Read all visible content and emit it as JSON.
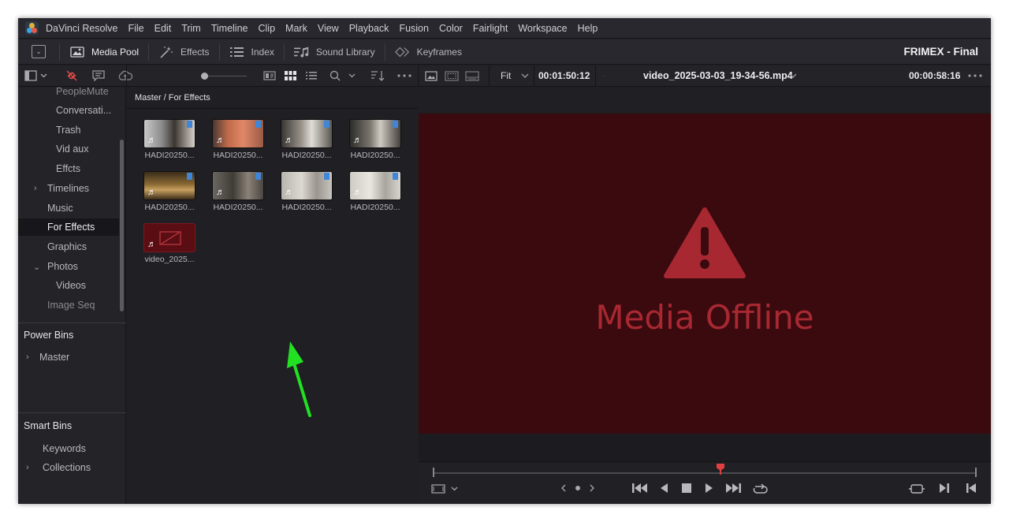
{
  "menubar": {
    "app_name": "DaVinci Resolve",
    "items": [
      "File",
      "Edit",
      "Trim",
      "Timeline",
      "Clip",
      "Mark",
      "View",
      "Playback",
      "Fusion",
      "Color",
      "Fairlight",
      "Workspace",
      "Help"
    ]
  },
  "toolbar": {
    "media_pool": "Media Pool",
    "effects": "Effects",
    "index": "Index",
    "sound_library": "Sound Library",
    "keyframes": "Keyframes",
    "project_title": "FRIMEX - Final"
  },
  "viewer_bar": {
    "zoom": "Fit",
    "source_timecode": "00:01:50:12",
    "clip_name": "video_2025-03-03_19-34-56.mp4",
    "duration_timecode": "00:00:58:16"
  },
  "sidebar": {
    "bins": [
      {
        "label": "PeopleMute"
      },
      {
        "label": "Conversati..."
      },
      {
        "label": "Trash"
      },
      {
        "label": "Vid aux"
      },
      {
        "label": "Effcts"
      },
      {
        "label": "Timelines"
      },
      {
        "label": "Music"
      },
      {
        "label": "For Effects"
      },
      {
        "label": "Graphics"
      },
      {
        "label": "Photos"
      },
      {
        "label": "Videos"
      },
      {
        "label": "Image Seq"
      }
    ],
    "selected_bin": "For Effects",
    "power_bins": {
      "title": "Power Bins",
      "items": [
        "Master"
      ]
    },
    "smart_bins": {
      "title": "Smart Bins",
      "items": [
        "Keywords",
        "Collections"
      ]
    }
  },
  "media_pool": {
    "path": "Master / For Effects",
    "clips": [
      {
        "name": "HADI20250..."
      },
      {
        "name": "HADI20250..."
      },
      {
        "name": "HADI20250..."
      },
      {
        "name": "HADI20250..."
      },
      {
        "name": "HADI20250..."
      },
      {
        "name": "HADI20250..."
      },
      {
        "name": "HADI20250..."
      },
      {
        "name": "HADI20250..."
      },
      {
        "name": "video_2025..."
      }
    ]
  },
  "viewer": {
    "message": "Media Offline"
  },
  "colors": {
    "accent_red": "#e04040",
    "offline_bg": "#3a0a0e",
    "offline_text": "#a82832",
    "annotation_arrow": "#22e022"
  }
}
